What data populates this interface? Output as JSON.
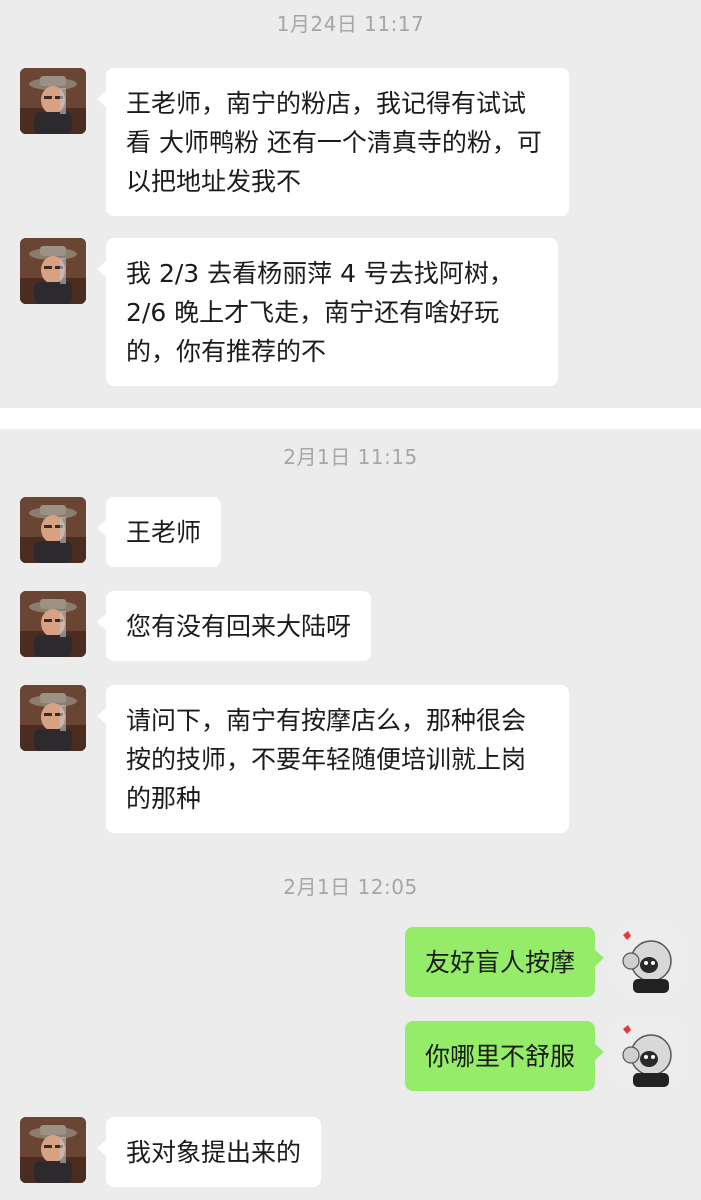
{
  "chat": {
    "section1": {
      "timestamp": "1月24日 11:17",
      "messages": [
        {
          "sender": "other",
          "text": "王老师，南宁的粉店，我记得有试试看 大师鸭粉 还有一个清真寺的粉，可以把地址发我不"
        },
        {
          "sender": "other",
          "text": "我 2/3 去看杨丽萍 4 号去找阿树，2/6 晚上才飞走，南宁还有啥好玩的，你有推荐的不"
        }
      ]
    },
    "section2": {
      "timestamp1": "2月1日 11:15",
      "messages1": [
        {
          "sender": "other",
          "text": "王老师"
        },
        {
          "sender": "other",
          "text": "您有没有回来大陆呀"
        },
        {
          "sender": "other",
          "text": "请问下，南宁有按摩店么，那种很会按的技师，不要年轻随便培训就上岗的那种"
        }
      ],
      "timestamp2": "2月1日 12:05",
      "messages2": [
        {
          "sender": "me",
          "text": "友好盲人按摩"
        },
        {
          "sender": "me",
          "text": "你哪里不舒服"
        },
        {
          "sender": "other",
          "text": "我对象提出来的"
        }
      ]
    }
  },
  "icons": {
    "other_avatar": "avatar-photo-icon",
    "my_avatar": "avatar-cartoon-icon"
  },
  "colors": {
    "background": "#ececec",
    "incoming_bubble": "#ffffff",
    "outgoing_bubble": "#95ec69",
    "timestamp_text": "#a6a6a6"
  }
}
